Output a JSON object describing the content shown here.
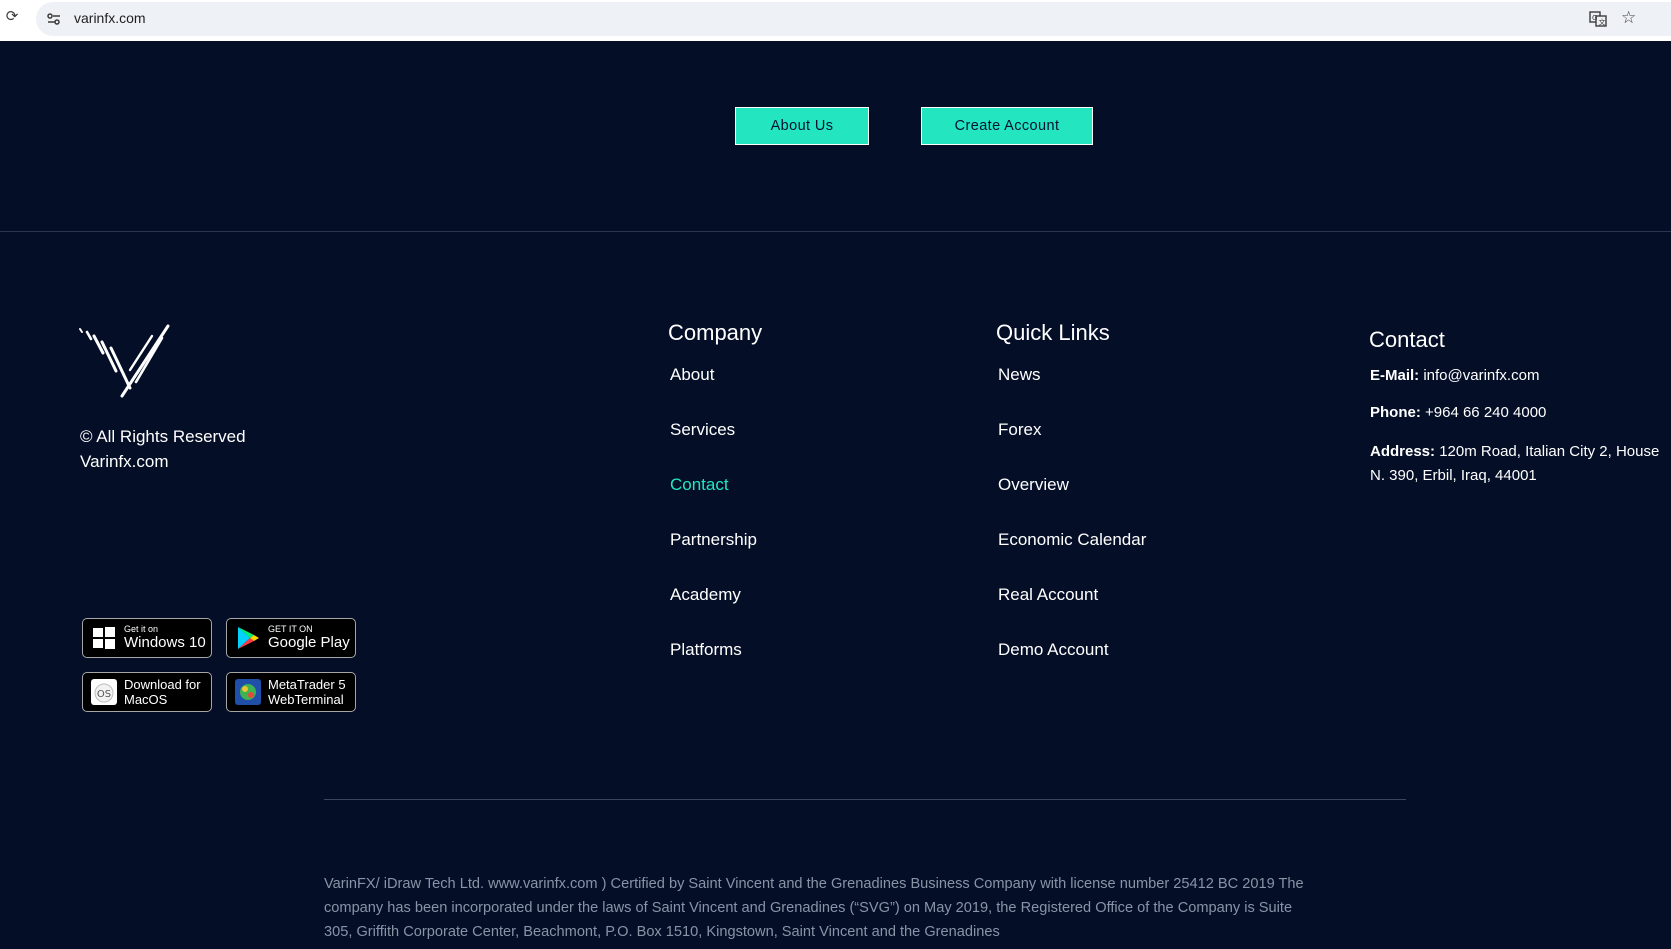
{
  "browser": {
    "url": "varinfx.com"
  },
  "hero": {
    "about_label": "About Us",
    "create_label": "Create Account"
  },
  "brand": {
    "rights_line1": "© All Rights Reserved",
    "rights_line2": "Varinfx.com"
  },
  "badges": {
    "windows": {
      "small": "Get it on",
      "big": "Windows 10"
    },
    "google": {
      "small": "GET IT ON",
      "big": "Google Play"
    },
    "mac": {
      "line1": "Download for",
      "line2": "MacOS"
    },
    "mt5": {
      "line1": "MetaTrader 5",
      "line2": "WebTerminal"
    }
  },
  "company": {
    "title": "Company",
    "links": [
      "About",
      "Services",
      "Contact",
      "Partnership",
      "Academy",
      "Platforms"
    ]
  },
  "quick_links": {
    "title": "Quick Links",
    "links": [
      "News",
      "Forex",
      "Overview",
      "Economic Calendar",
      "Real Account",
      "Demo Account"
    ]
  },
  "contact": {
    "title": "Contact",
    "email_label": "E-Mail:",
    "email": "info@varinfx.com",
    "phone_label": "Phone:",
    "phone": "+964 66 240 4000",
    "address_label": "Address:",
    "address": "120m Road, Italian City 2, House N. 390, Erbil, Iraq, 44001"
  },
  "legal": "VarinFX/ iDraw Tech Ltd. www.varinfx.com ) Certified by Saint Vincent and the Grenadines Business Company with license number 25412 BC 2019 The company has been incorporated under the laws of Saint Vincent and Grenadines (“SVG”) on May 2019, the Registered Office of the Company is Suite 305, Griffith Corporate Center, Beachmont, P.O. Box 1510, Kingstown, Saint Vincent and the Grenadines",
  "colors": {
    "background": "#040e27",
    "accent": "#23e6c1",
    "muted_text": "#8a93a6"
  }
}
